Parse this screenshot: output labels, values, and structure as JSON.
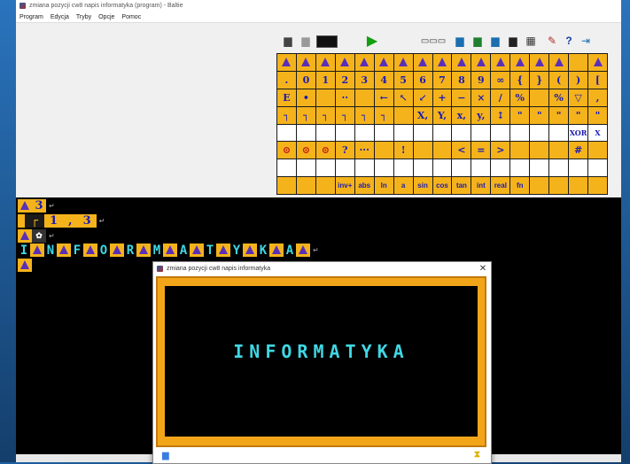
{
  "window": {
    "title": "zmiana pozycji cw8 napis informatyka (program) - Baltie"
  },
  "menu": [
    "Program",
    "Edycja",
    "Tryby",
    "Opcje",
    "Pomoc"
  ],
  "toolbar": {
    "help_label": "?"
  },
  "palette": [
    [
      "wiz",
      "wiz",
      "wiz",
      "wiz",
      "wiz",
      "wiz",
      "wiz",
      "wiz",
      "wiz",
      "wiz",
      "wiz",
      "wiz",
      "wiz",
      "wiz",
      "wiz",
      "",
      "wiz"
    ],
    [
      ".",
      "0",
      "1",
      "2",
      "3",
      "4",
      "5",
      "6",
      "7",
      "8",
      "9",
      "∞",
      "{",
      "}",
      "(",
      ")",
      "["
    ],
    [
      "E",
      "•",
      "",
      "··",
      "",
      "←",
      "↖",
      "↙",
      "+",
      "−",
      "×",
      "∕",
      "%",
      "",
      "%",
      "▽",
      ","
    ],
    [
      "┐",
      "┐",
      "┐",
      "┐",
      "┐",
      "┐",
      "",
      "X,",
      "Y,",
      "x,",
      "y,",
      "↕",
      "\"",
      "\"",
      "\"",
      "\"",
      "\""
    ],
    [
      "",
      "",
      "",
      "",
      "",
      "",
      "",
      "",
      "",
      "",
      "",
      "",
      "",
      "",
      "",
      "XOR",
      "X"
    ],
    [
      "⊙",
      "⊙",
      "⊙",
      "?",
      "···",
      "",
      "!",
      "",
      "",
      "<",
      "=",
      ">",
      "",
      "",
      "",
      "#",
      ""
    ],
    [
      "",
      "",
      "",
      "",
      "",
      "",
      "",
      "",
      "",
      "",
      "",
      "",
      "",
      "",
      "",
      "",
      ""
    ],
    [
      "",
      "",
      "",
      "inv+",
      "abs",
      "ln",
      "a",
      "sin",
      "cos",
      "tan",
      "int",
      "real",
      "fn",
      "",
      "",
      "",
      ""
    ]
  ],
  "program": {
    "line1": {
      "num": "3"
    },
    "line2": {
      "a": "1",
      "sep": ",",
      "b": "3"
    },
    "letters": [
      "I",
      "N",
      "F",
      "O",
      "R",
      "M",
      "A",
      "T",
      "Y",
      "K",
      "A"
    ]
  },
  "dialog": {
    "title": "zmiana pozycji cw8 napis informatyka",
    "close": "✕",
    "output_text": "INFORMATYKA"
  }
}
